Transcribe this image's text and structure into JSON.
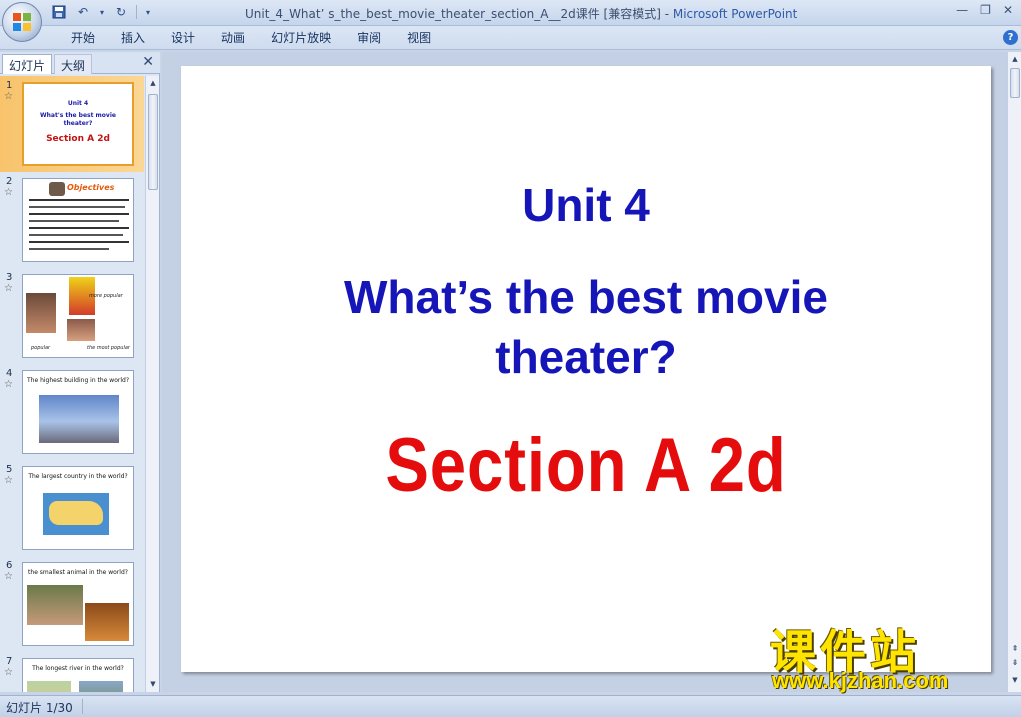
{
  "window": {
    "title": "Unit_4_What’ s_the_best_movie_theater_section_A__2d课件 [兼容模式] - ",
    "app_name": "Microsoft PowerPoint"
  },
  "ribbon": {
    "tabs": [
      "开始",
      "插入",
      "设计",
      "动画",
      "幻灯片放映",
      "审阅",
      "视图"
    ]
  },
  "left_pane": {
    "tab_slides": "幻灯片",
    "tab_outline": "大纲",
    "thumbnails": [
      {
        "number": "1",
        "line1": "Unit 4",
        "line2": "What's the best movie",
        "line3": "theater?",
        "line4": "Section A 2d"
      },
      {
        "number": "2",
        "heading": "Objectives"
      },
      {
        "number": "3",
        "label_a": "more popular",
        "label_b": "popular",
        "label_c": "the most popular"
      },
      {
        "number": "4",
        "caption": "The highest building in the world?"
      },
      {
        "number": "5",
        "caption": "The largest country in the world?"
      },
      {
        "number": "6",
        "caption": "the smallest animal in the world?"
      },
      {
        "number": "7",
        "caption": "The longest river in the world?"
      }
    ]
  },
  "slide": {
    "unit": "Unit 4",
    "question_line1": "What’s the best movie",
    "question_line2": "theater?",
    "section": "Section A  2d"
  },
  "watermark": {
    "chinese": "课件站",
    "url": "www.kjzhan.com"
  },
  "status": {
    "slide_indicator": "幻灯片 1/30"
  },
  "colors": {
    "slide_blue": "#1515b8",
    "slide_red": "#e40c0c",
    "selected_thumb": "#f8c36b",
    "watermark_yellow": "#ffe400"
  }
}
